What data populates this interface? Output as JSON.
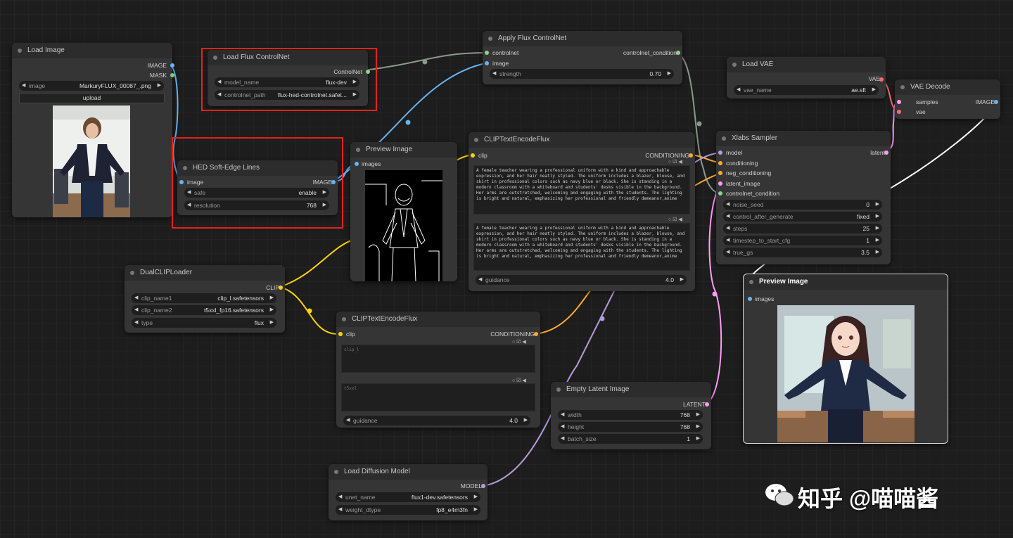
{
  "nodes": {
    "load_image": {
      "title": "Load Image",
      "out_image": "IMAGE",
      "out_mask": "MASK",
      "w_image_label": "image",
      "w_image_value": "MarkuryFLUX_00087_.png",
      "upload": "upload"
    },
    "load_controlnet": {
      "title": "Load Flux ControlNet",
      "out": "ControlNet",
      "w1_label": "model_name",
      "w1_value": "flux-dev",
      "w2_label": "controlnet_path",
      "w2_value": "flux-hed-controlnet.safet..."
    },
    "apply_controlnet": {
      "title": "Apply Flux ControlNet",
      "in1": "controlnet",
      "in2": "image",
      "out": "controlnet_condition",
      "w_label": "strength",
      "w_value": "0.70"
    },
    "hed": {
      "title": "HED Soft-Edge Lines",
      "in": "image",
      "out": "IMAGE",
      "w1_label": "safe",
      "w1_value": "enable",
      "w2_label": "resolution",
      "w2_value": "768"
    },
    "preview1": {
      "title": "Preview Image",
      "in": "images"
    },
    "clip1": {
      "title": "CLIPTextEncodeFlux",
      "in": "clip",
      "out": "CONDITIONING",
      "text1": "A female teacher wearing a professional uniform with a kind and approachable expression, and her hair neatly styled. The uniform includes a blazer, blouse, and skirt in professional colors such as navy blue or black. She is standing in a modern classroom with a whiteboard and students' desks visible in the background. Her arms are outstretched, welcoming and engaging with the students. The lighting is bright and natural, emphasizing her professional and friendly demeanor,anime",
      "text2": "A female teacher wearing a professional uniform with a kind and approachable expression, and her hair neatly styled. The uniform includes a blazer, blouse, and skirt in professional colors such as navy blue or black. She is standing in a modern classroom with a whiteboard and students' desks visible in the background. Her arms are outstretched, welcoming and engaging with the students. The lighting is bright and natural, emphasizing her professional and friendly demeanor,anime",
      "w_label": "guidance",
      "w_value": "4.0"
    },
    "load_vae": {
      "title": "Load VAE",
      "out": "VAE",
      "w_label": "vae_name",
      "w_value": "ae.sft"
    },
    "vae_decode": {
      "title": "VAE Decode",
      "in1": "samples",
      "in2": "vae",
      "out": "IMAGE"
    },
    "sampler": {
      "title": "Xlabs Sampler",
      "in1": "model",
      "in2": "conditioning",
      "in3": "neg_conditioning",
      "in4": "latent_image",
      "in5": "controlnet_condition",
      "out": "latent",
      "widgets": [
        {
          "label": "noise_seed",
          "value": "0"
        },
        {
          "label": "control_after_generate",
          "value": "fixed"
        },
        {
          "label": "steps",
          "value": "25"
        },
        {
          "label": "timestep_to_start_cfg",
          "value": "1"
        },
        {
          "label": "true_gs",
          "value": "3.5"
        }
      ]
    },
    "dualclip": {
      "title": "DualCLIPLoader",
      "out": "CLIP",
      "w1_label": "clip_name1",
      "w1_value": "clip_l.safetensors",
      "w2_label": "clip_name2",
      "w2_value": "t5xxl_fp16.safetensors",
      "w3_label": "type",
      "w3_value": "flux"
    },
    "clip2": {
      "title": "CLIPTextEncodeFlux",
      "in": "clip",
      "out": "CONDITIONING",
      "ph1": "clip_l",
      "ph2": "t5xxl",
      "w_label": "guidance",
      "w_value": "4.0"
    },
    "empty_latent": {
      "title": "Empty Latent Image",
      "out": "LATENT",
      "w1_label": "width",
      "w1_value": "768",
      "w2_label": "height",
      "w2_value": "768",
      "w3_label": "batch_size",
      "w3_value": "1"
    },
    "preview2": {
      "title": "Preview Image",
      "in": "images"
    },
    "load_model": {
      "title": "Load Diffusion Model",
      "out": "MODEL",
      "w1_label": "unet_name",
      "w1_value": "flux1-dev.safetensors",
      "w2_label": "weight_dtype",
      "w2_value": "fp8_e4m3fn"
    }
  },
  "watermark": "知乎 @喵喵酱",
  "colors": {
    "image_sock": "#64b5f6",
    "mask_sock": "#81c784",
    "cond_sock": "#ffa931",
    "clip_sock": "#ffd500",
    "model_sock": "#b39ddb",
    "latent_sock": "#ff9cf9",
    "vae_sock": "#ff6e6e",
    "highlight": "#e2231a"
  }
}
